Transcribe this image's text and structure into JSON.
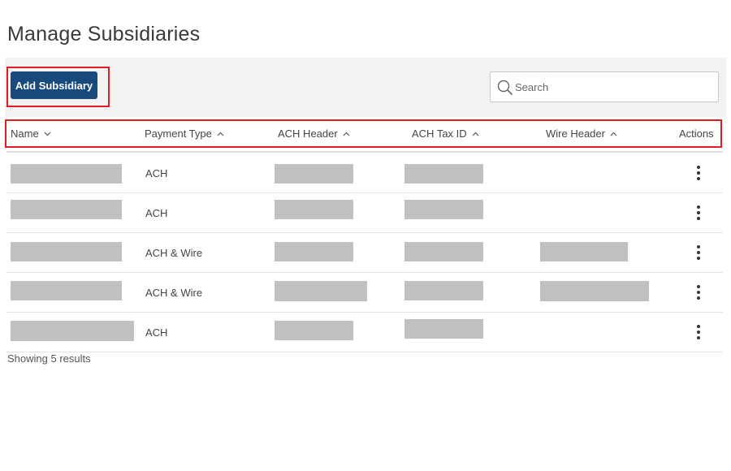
{
  "page": {
    "title": "Manage Subsidiaries"
  },
  "toolbar": {
    "add_label": "Add Subsidiary",
    "search_placeholder": "Search"
  },
  "table": {
    "columns": [
      {
        "label": "Name",
        "sort": "descending"
      },
      {
        "label": "Payment Type",
        "sort": "ascending"
      },
      {
        "label": "ACH Header",
        "sort": "ascending"
      },
      {
        "label": "ACH Tax ID",
        "sort": "ascending"
      },
      {
        "label": "Wire Header",
        "sort": "ascending"
      },
      {
        "label": "Actions",
        "sort": "none"
      }
    ],
    "rows": [
      {
        "payment_type": "ACH",
        "wire_header_present": false
      },
      {
        "payment_type": "ACH",
        "wire_header_present": false
      },
      {
        "payment_type": "ACH & Wire",
        "wire_header_present": true
      },
      {
        "payment_type": "ACH & Wire",
        "wire_header_present": true
      },
      {
        "payment_type": "ACH",
        "wire_header_present": false
      }
    ],
    "redaction_color": "#c0c0c0"
  },
  "footer": {
    "results_text": "Showing 5 results"
  },
  "colors": {
    "primary_button": "#184a7c",
    "highlight_border": "#e31b23",
    "toolbar_bg": "#f2f2f2"
  },
  "icons": {
    "search": "search-icon",
    "sort_up": "chevron-up-icon",
    "sort_down": "chevron-down-icon",
    "row_actions": "kebab-menu-icon"
  }
}
